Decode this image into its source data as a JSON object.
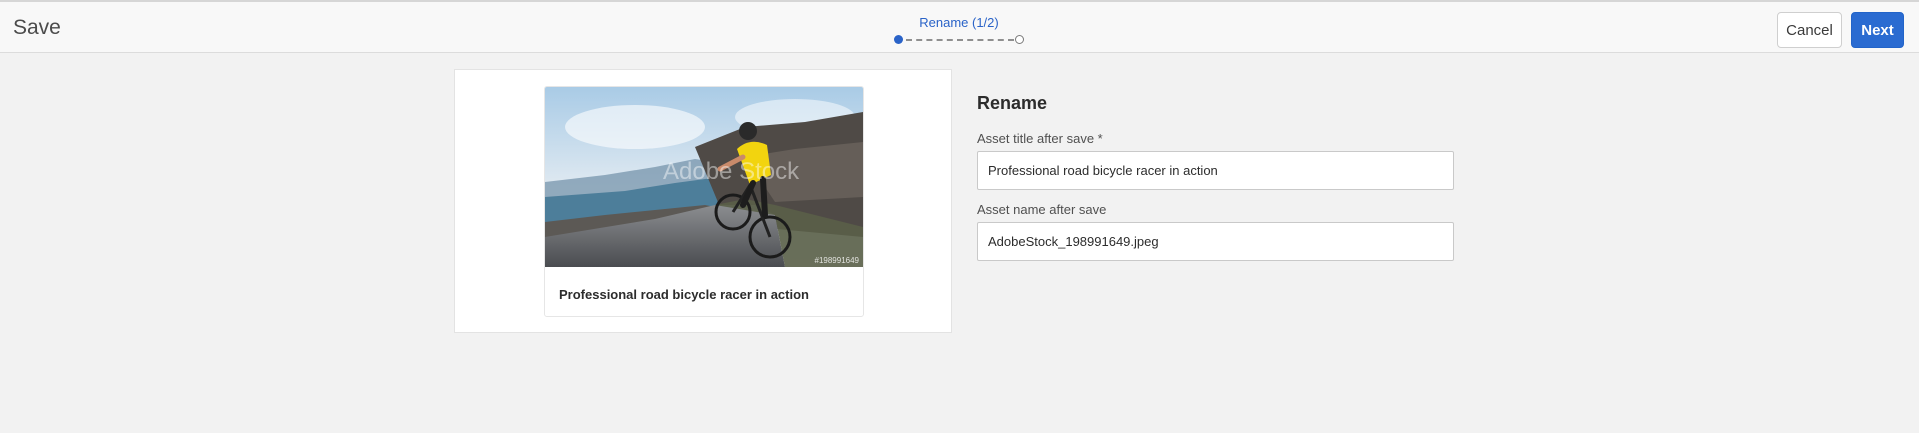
{
  "header": {
    "title": "Save",
    "step_label": "Rename (1/2)",
    "step_current": 1,
    "step_total": 2,
    "cancel_label": "Cancel",
    "next_label": "Next",
    "accent_color": "#2a6bd1"
  },
  "preview": {
    "image_subject": "road-cyclist-photo",
    "watermark_text": "Adobe Stock",
    "image_id_overlay": "#198991649",
    "card_title": "Professional road bicycle racer in action"
  },
  "form": {
    "heading": "Rename",
    "title_label": "Asset title after save *",
    "title_value": "Professional road bicycle racer in action",
    "name_label": "Asset name after save",
    "name_value": "AdobeStock_198991649.jpeg"
  }
}
